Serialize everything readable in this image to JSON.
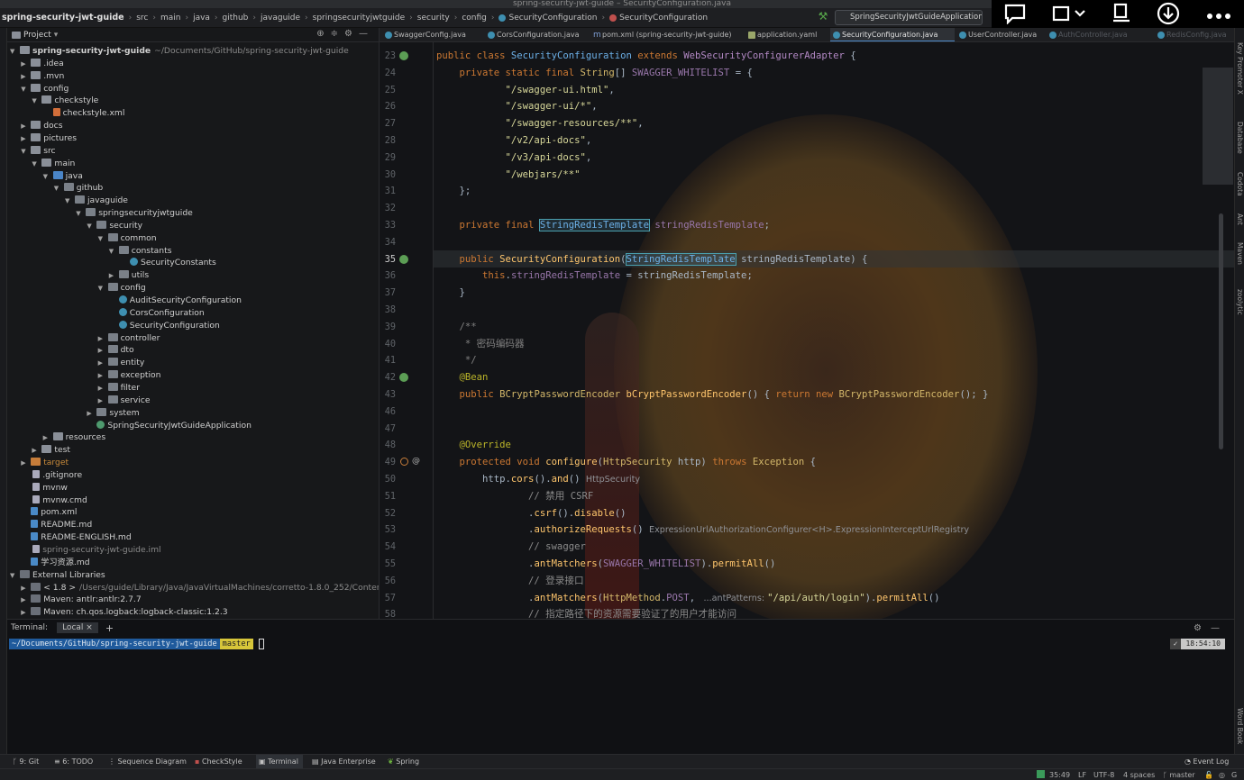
{
  "window_title": "spring-security-jwt-guide – SecurityConfiguration.java",
  "breadcrumb": {
    "project": "spring-security-jwt-guide",
    "items": [
      "src",
      "main",
      "java",
      "github",
      "javaguide",
      "springsecurityjwtguide",
      "security",
      "config",
      "SecurityConfiguration",
      "SecurityConfiguration"
    ]
  },
  "run_config": "SpringSecurityJwtGuideApplication",
  "project_panel": {
    "title": "Project",
    "tree": [
      {
        "label": "spring-security-jwt-guide",
        "extra": "~/Documents/GitHub/spring-security-jwt-guide",
        "depth": 0,
        "expanded": true,
        "icon": "module-folder-icon",
        "bold": true
      },
      {
        "label": ".idea",
        "depth": 1,
        "expanded": false,
        "icon": "folder-icon"
      },
      {
        "label": ".mvn",
        "depth": 1,
        "expanded": false,
        "icon": "folder-icon"
      },
      {
        "label": "config",
        "depth": 1,
        "expanded": true,
        "icon": "folder-icon"
      },
      {
        "label": "checkstyle",
        "depth": 2,
        "expanded": true,
        "icon": "folder-icon"
      },
      {
        "label": "checkstyle.xml",
        "depth": 3,
        "icon": "xml-file-icon"
      },
      {
        "label": "docs",
        "depth": 1,
        "expanded": false,
        "icon": "folder-icon"
      },
      {
        "label": "pictures",
        "depth": 1,
        "expanded": false,
        "icon": "folder-icon"
      },
      {
        "label": "src",
        "depth": 1,
        "expanded": true,
        "icon": "folder-icon"
      },
      {
        "label": "main",
        "depth": 2,
        "expanded": true,
        "icon": "folder-icon"
      },
      {
        "label": "java",
        "depth": 3,
        "expanded": true,
        "icon": "source-folder-icon"
      },
      {
        "label": "github",
        "depth": 4,
        "expanded": true,
        "icon": "package-icon"
      },
      {
        "label": "javaguide",
        "depth": 5,
        "expanded": true,
        "icon": "package-icon"
      },
      {
        "label": "springsecurityjwtguide",
        "depth": 6,
        "expanded": true,
        "icon": "package-icon"
      },
      {
        "label": "security",
        "depth": 7,
        "expanded": true,
        "icon": "package-icon"
      },
      {
        "label": "common",
        "depth": 8,
        "expanded": true,
        "icon": "package-icon"
      },
      {
        "label": "constants",
        "depth": 9,
        "expanded": true,
        "icon": "package-icon"
      },
      {
        "label": "SecurityConstants",
        "depth": 10,
        "icon": "class-icon"
      },
      {
        "label": "utils",
        "depth": 9,
        "expanded": false,
        "icon": "package-icon"
      },
      {
        "label": "config",
        "depth": 8,
        "expanded": true,
        "icon": "package-icon"
      },
      {
        "label": "AuditSecurityConfiguration",
        "depth": 9,
        "icon": "class-icon"
      },
      {
        "label": "CorsConfiguration",
        "depth": 9,
        "icon": "class-icon"
      },
      {
        "label": "SecurityConfiguration",
        "depth": 9,
        "icon": "class-icon"
      },
      {
        "label": "controller",
        "depth": 8,
        "expanded": false,
        "icon": "package-icon"
      },
      {
        "label": "dto",
        "depth": 8,
        "expanded": false,
        "icon": "package-icon"
      },
      {
        "label": "entity",
        "depth": 8,
        "expanded": false,
        "icon": "package-icon"
      },
      {
        "label": "exception",
        "depth": 8,
        "expanded": false,
        "icon": "package-icon"
      },
      {
        "label": "filter",
        "depth": 8,
        "expanded": false,
        "icon": "package-icon"
      },
      {
        "label": "service",
        "depth": 8,
        "expanded": false,
        "icon": "package-icon"
      },
      {
        "label": "system",
        "depth": 7,
        "expanded": false,
        "icon": "package-icon"
      },
      {
        "label": "SpringSecurityJwtGuideApplication",
        "depth": 7,
        "icon": "spring-boot-class-icon"
      },
      {
        "label": "resources",
        "depth": 3,
        "expanded": false,
        "icon": "folder-icon"
      },
      {
        "label": "test",
        "depth": 2,
        "expanded": false,
        "icon": "folder-icon"
      },
      {
        "label": "target",
        "depth": 1,
        "expanded": false,
        "icon": "excluded-folder-icon",
        "dim": true
      },
      {
        "label": ".gitignore",
        "depth": 1,
        "icon": "file-icon"
      },
      {
        "label": "mvnw",
        "depth": 1,
        "icon": "file-icon"
      },
      {
        "label": "mvnw.cmd",
        "depth": 1,
        "icon": "file-icon"
      },
      {
        "label": "pom.xml",
        "depth": 1,
        "icon": "maven-file-icon"
      },
      {
        "label": "README.md",
        "depth": 1,
        "icon": "markdown-file-icon"
      },
      {
        "label": "README-ENGLISH.md",
        "depth": 1,
        "icon": "markdown-file-icon"
      },
      {
        "label": "spring-security-jwt-guide.iml",
        "depth": 1,
        "icon": "iml-file-icon",
        "dim": true
      },
      {
        "label": "学习资源.md",
        "depth": 1,
        "icon": "markdown-file-icon"
      },
      {
        "label": "External Libraries",
        "depth": 0,
        "expanded": true,
        "icon": "library-icon"
      },
      {
        "label": "< 1.8 >",
        "extra": "/Users/guide/Library/Java/JavaVirtualMachines/corretto-1.8.0_252/Contents/",
        "depth": 1,
        "expanded": false,
        "icon": "jdk-icon"
      },
      {
        "label": "Maven: antlr:antlr:2.7.7",
        "depth": 1,
        "expanded": false,
        "icon": "library-icon"
      },
      {
        "label": "Maven: ch.qos.logback:logback-classic:1.2.3",
        "depth": 1,
        "expanded": false,
        "icon": "library-icon"
      }
    ]
  },
  "editor_tabs": [
    {
      "label": "SwaggerConfig.java",
      "active": false
    },
    {
      "label": "CorsConfiguration.java",
      "active": false
    },
    {
      "label": "pom.xml (spring-security-jwt-guide)",
      "active": false
    },
    {
      "label": "application.yaml",
      "active": false
    },
    {
      "label": "SecurityConfiguration.java",
      "active": true
    },
    {
      "label": "UserController.java",
      "active": false
    },
    {
      "label": "AuthController.java",
      "active": false,
      "faded": true
    },
    {
      "label": "RedisConfig.java",
      "active": false,
      "faded": true
    }
  ],
  "editor": {
    "current_line": 35,
    "lines": [
      {
        "n": 23,
        "html": "<span class='kw'>public class </span><span class='cls2'>SecurityConfiguration </span><span class='kw'>extends </span><span class='pur'>WebSecurityConfigurerAdapter</span> {"
      },
      {
        "n": 24,
        "html": "    <span class='kw'>private static final </span><span class='ty'>String</span>[] <span class='fld'>SWAGGER_WHITELIST</span> = {"
      },
      {
        "n": 25,
        "html": "            <span class='str'>\"/swagger-ui.html\"</span>,"
      },
      {
        "n": 26,
        "html": "            <span class='str'>\"/swagger-ui/*\"</span>,"
      },
      {
        "n": 27,
        "html": "            <span class='str'>\"/swagger-resources/**\"</span>,"
      },
      {
        "n": 28,
        "html": "            <span class='str'>\"/v2/api-docs\"</span>,"
      },
      {
        "n": 29,
        "html": "            <span class='str'>\"/v3/api-docs\"</span>,"
      },
      {
        "n": 30,
        "html": "            <span class='str'>\"/webjars/**\"</span>"
      },
      {
        "n": 31,
        "html": "    };"
      },
      {
        "n": 32,
        "html": ""
      },
      {
        "n": 33,
        "html": "    <span class='kw'>private final </span><span class='cls2 box'>StringRedisTemplate</span> <span class='fld'>stringRedisTemplate</span>;"
      },
      {
        "n": 34,
        "html": ""
      },
      {
        "n": 35,
        "html": "    <span class='kw'>public </span><span class='fn'>SecurityConfiguration</span>(<span class='cls2 box'>StringRedisTemplate</span> stringRedisTemplate) {"
      },
      {
        "n": 36,
        "html": "        <span class='kw'>this</span>.<span class='fld'>stringRedisTemplate</span> = stringRedisTemplate;"
      },
      {
        "n": 37,
        "html": "    }"
      },
      {
        "n": 38,
        "html": ""
      },
      {
        "n": 39,
        "html": "    <span class='cm'>/**</span>"
      },
      {
        "n": 40,
        "html": "<span class='cm'>     * 密码编码器</span>"
      },
      {
        "n": 41,
        "html": "<span class='cm'>     */</span>"
      },
      {
        "n": 42,
        "html": "    <span class='an'>@Bean</span>"
      },
      {
        "n": 43,
        "html": "    <span class='kw'>public </span><span class='ty'>BCryptPasswordEncoder</span> <span class='fn'>bCryptPasswordEncoder</span>() { <span class='kw'>return new </span><span class='ty'>BCryptPasswordEncoder</span>(); }"
      },
      {
        "n": 46,
        "html": ""
      },
      {
        "n": 47,
        "html": ""
      },
      {
        "n": 48,
        "html": "    <span class='an'>@Override</span>"
      },
      {
        "n": 49,
        "html": "    <span class='kw'>protected void </span><span class='fn'>configure</span>(<span class='ty'>HttpSecurity</span> http) <span class='kw'>throws </span><span class='ty'>Exception</span> {"
      },
      {
        "n": 50,
        "html": "        http.<span class='fn'>cors</span>().<span class='fn'>and</span>() <span class='hint'>HttpSecurity</span>"
      },
      {
        "n": 51,
        "html": "<span class='cmt'>                // 禁用 CSRF</span>"
      },
      {
        "n": 52,
        "html": "                .<span class='fn'>csrf</span>().<span class='fn'>disable</span>()"
      },
      {
        "n": 53,
        "html": "                .<span class='fn'>authorizeRequests</span>() <span class='hint'>ExpressionUrlAuthorizationConfigurer&lt;H&gt;.ExpressionInterceptUrlRegistry</span>"
      },
      {
        "n": 54,
        "html": "<span class='cmt'>                // swagger</span>"
      },
      {
        "n": 55,
        "html": "                .<span class='fn'>antMatchers</span>(<span class='fld'>SWAGGER_WHITELIST</span>).<span class='fn'>permitAll</span>()"
      },
      {
        "n": 56,
        "html": "<span class='cmt'>                // 登录接口</span>"
      },
      {
        "n": 57,
        "html": "                .<span class='fn'>antMatchers</span>(<span class='ty'>HttpMethod</span>.<span class='fld'>POST</span>, <span class='hint'> ...antPatterns: </span><span class='str'>\"/api/auth/login\"</span>).<span class='fn'>permitAll</span>()"
      },
      {
        "n": 58,
        "html": "<span class='cmt'>                // 指定路径下的资源需要验证了的用户才能访问</span>"
      }
    ]
  },
  "terminal": {
    "title": "Terminal:",
    "tab": "Local",
    "add": "+",
    "prompt_path": "~/Documents/GitHub/spring-security-jwt-guide",
    "prompt_branch": "master",
    "time": "18:54:10"
  },
  "tool_windows": [
    {
      "label": "9: Git",
      "icon": "git-branch-icon"
    },
    {
      "label": "6: TODO",
      "icon": "todo-icon"
    },
    {
      "label": "Sequence Diagram",
      "icon": "sequence-diagram-icon"
    },
    {
      "label": "CheckStyle",
      "icon": "checkstyle-icon"
    },
    {
      "label": "Terminal",
      "icon": "terminal-icon",
      "active": true
    },
    {
      "label": "Java Enterprise",
      "icon": "java-enterprise-icon"
    },
    {
      "label": "Spring",
      "icon": "spring-icon"
    }
  ],
  "event_log": "Event Log",
  "right_tool_windows": [
    "Key Promoter X",
    "Database",
    "Codota",
    "Ant",
    "Maven",
    "zoolytic",
    "Word Book"
  ],
  "status": {
    "position": "35:49",
    "line_sep": "LF",
    "encoding": "UTF-8",
    "indent": "4 spaces",
    "branch": "master"
  }
}
